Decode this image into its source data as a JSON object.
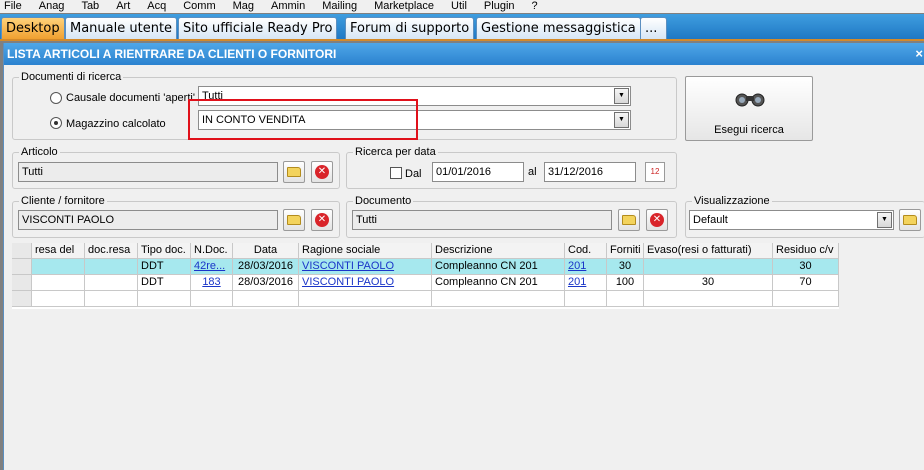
{
  "menu": [
    "File",
    "Anag",
    "Tab",
    "Art",
    "Acq",
    "Comm",
    "Mag",
    "Ammin",
    "Mailing",
    "Marketplace",
    "Util",
    "Plugin",
    "?"
  ],
  "tabs": [
    "Desktop",
    "Manuale utente",
    "Sito ufficiale Ready Pro",
    "Forum di supporto",
    "Gestione messaggistica",
    "..."
  ],
  "window": {
    "title": "LISTA ARTICOLI A RIENTRARE DA CLIENTI O FORNITORI",
    "close": "×"
  },
  "documenti": {
    "label": "Documenti di ricerca",
    "causale_label": "Causale documenti 'aperti'",
    "causale_value": "Tutti",
    "magazzino_label": "Magazzino calcolato",
    "magazzino_value": "IN CONTO VENDITA"
  },
  "search_button": {
    "label": "Esegui ricerca"
  },
  "articolo": {
    "label": "Articolo",
    "value": "Tutti"
  },
  "ricerca_data": {
    "label": "Ricerca per data",
    "dal_label": "Dal",
    "dal_value": "01/01/2016",
    "al_label": "al",
    "al_value": "31/12/2016",
    "cal_icon": "12"
  },
  "cliente": {
    "label": "Cliente / fornitore",
    "value": "VISCONTI PAOLO"
  },
  "documento": {
    "label": "Documento",
    "value": "Tutti"
  },
  "visualizzazione": {
    "label": "Visualizzazione",
    "value": "Default"
  },
  "table": {
    "headers": [
      "resa del",
      "doc.resa",
      "Tipo doc.",
      "N.Doc.",
      "Data",
      "Ragione sociale",
      "Descrizione",
      "Cod.",
      "Forniti",
      "Evaso(resi o fatturati)",
      "Residuo c/v"
    ],
    "rows": [
      [
        "",
        "",
        "DDT",
        "42re...",
        "28/03/2016",
        "VISCONTI PAOLO",
        "Compleanno CN 201",
        "201",
        "30",
        "",
        "30"
      ],
      [
        "",
        "",
        "DDT",
        "183",
        "28/03/2016",
        "VISCONTI PAOLO",
        "Compleanno CN 201",
        "201",
        "100",
        "30",
        "70"
      ]
    ]
  },
  "colors": {
    "tabbar": "#2b82cf",
    "active_tab": "#f0a030",
    "highlight": "#e0101a",
    "selected_row": "#a6e8ee",
    "link": "#1a35c8"
  }
}
